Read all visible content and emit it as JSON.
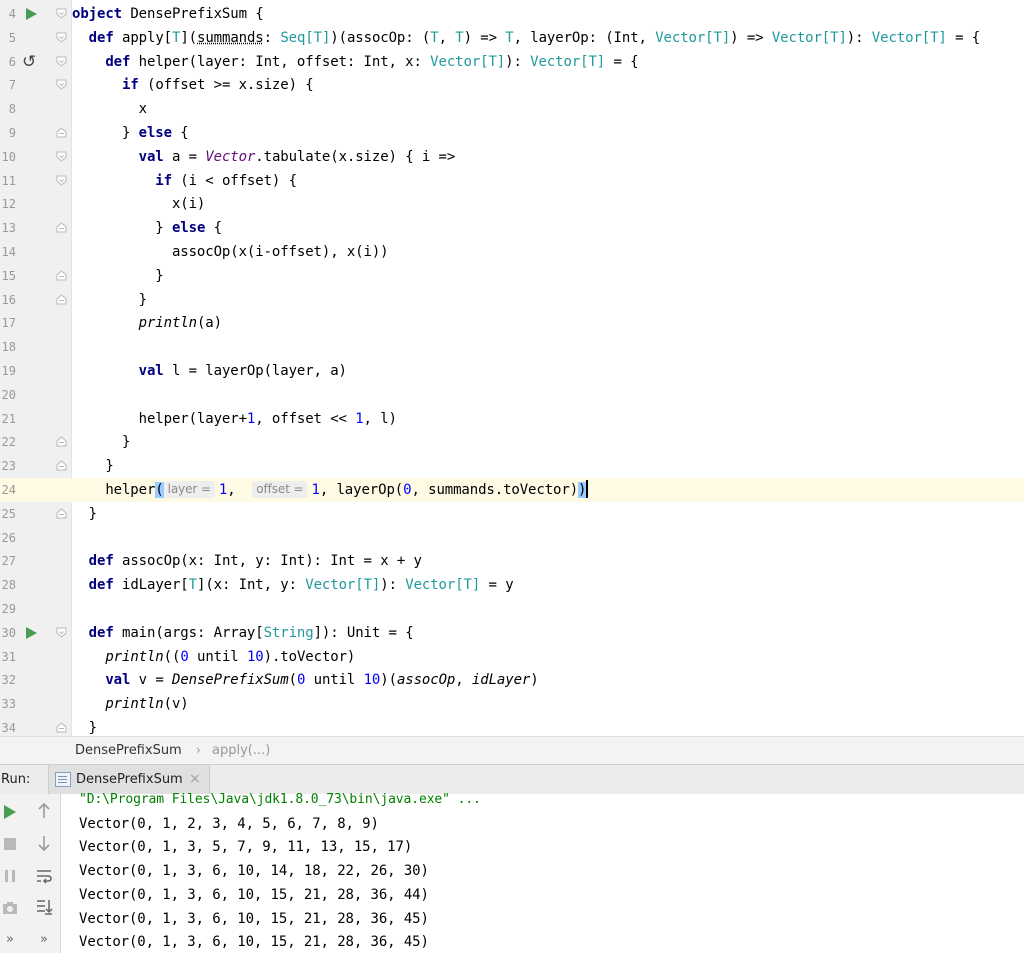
{
  "editor": {
    "file": "DensePrefixSum",
    "lines": [
      {
        "n": "4",
        "tokens": [
          [
            "kw",
            "object"
          ],
          [
            "",
            " DensePrefixSum {"
          ]
        ]
      },
      {
        "n": "5",
        "tokens": [
          [
            "",
            "  "
          ],
          [
            "kw",
            "def"
          ],
          [
            "",
            " apply["
          ],
          [
            "tp",
            "T"
          ],
          [
            "",
            "]("
          ],
          [
            "under",
            "summands"
          ],
          [
            "",
            ": "
          ],
          [
            "tp",
            "Seq[T]"
          ],
          [
            "",
            ")(assocOp: ("
          ],
          [
            "tp",
            "T"
          ],
          [
            "",
            ", "
          ],
          [
            "tp",
            "T"
          ],
          [
            "",
            ") => "
          ],
          [
            "tp",
            "T"
          ],
          [
            "",
            ", layerOp: (Int, "
          ],
          [
            "tp",
            "Vector[T]"
          ],
          [
            "",
            ") => "
          ],
          [
            "tp",
            "Vector[T]"
          ],
          [
            "",
            "): "
          ],
          [
            "tp",
            "Vector[T]"
          ],
          [
            "",
            " = {"
          ]
        ]
      },
      {
        "n": "6",
        "tokens": [
          [
            "",
            "    "
          ],
          [
            "kw",
            "def"
          ],
          [
            "",
            " helper(layer: Int, offset: Int, x: "
          ],
          [
            "tp",
            "Vector[T]"
          ],
          [
            "",
            "): "
          ],
          [
            "tp",
            "Vector[T]"
          ],
          [
            "",
            " = {"
          ]
        ]
      },
      {
        "n": "7",
        "tokens": [
          [
            "",
            "      "
          ],
          [
            "kw",
            "if"
          ],
          [
            "",
            " (offset >= x.size) {"
          ]
        ]
      },
      {
        "n": "8",
        "tokens": [
          [
            "",
            "        x"
          ]
        ]
      },
      {
        "n": "9",
        "tokens": [
          [
            "",
            "      } "
          ],
          [
            "kw",
            "else"
          ],
          [
            "",
            " {"
          ]
        ]
      },
      {
        "n": "10",
        "tokens": [
          [
            "",
            "        "
          ],
          [
            "kw",
            "val"
          ],
          [
            "",
            " a = "
          ],
          [
            "obj",
            "Vector"
          ],
          [
            "",
            ".tabulate(x.size) { i =>"
          ]
        ]
      },
      {
        "n": "11",
        "tokens": [
          [
            "",
            "          "
          ],
          [
            "kw",
            "if"
          ],
          [
            "",
            " (i < offset) {"
          ]
        ]
      },
      {
        "n": "12",
        "tokens": [
          [
            "",
            "            x(i)"
          ]
        ]
      },
      {
        "n": "13",
        "tokens": [
          [
            "",
            "          } "
          ],
          [
            "kw",
            "else"
          ],
          [
            "",
            " {"
          ]
        ]
      },
      {
        "n": "14",
        "tokens": [
          [
            "",
            "            assocOp(x(i-offset), x(i))"
          ]
        ]
      },
      {
        "n": "15",
        "tokens": [
          [
            "",
            "          }"
          ]
        ]
      },
      {
        "n": "16",
        "tokens": [
          [
            "",
            "        }"
          ]
        ]
      },
      {
        "n": "17",
        "tokens": [
          [
            "",
            "        "
          ],
          [
            "it",
            "println"
          ],
          [
            "",
            "(a)"
          ]
        ]
      },
      {
        "n": "18",
        "tokens": []
      },
      {
        "n": "19",
        "tokens": [
          [
            "",
            "        "
          ],
          [
            "kw",
            "val"
          ],
          [
            "",
            " l = layerOp(layer, a)"
          ]
        ]
      },
      {
        "n": "20",
        "tokens": []
      },
      {
        "n": "21",
        "tokens": [
          [
            "",
            "        helper(layer+"
          ],
          [
            "num",
            "1"
          ],
          [
            "",
            ", offset << "
          ],
          [
            "num",
            "1"
          ],
          [
            "",
            ", l)"
          ]
        ]
      },
      {
        "n": "22",
        "tokens": [
          [
            "",
            "      }"
          ]
        ]
      },
      {
        "n": "23",
        "tokens": [
          [
            "",
            "    }"
          ]
        ]
      },
      {
        "n": "24",
        "tokens": [
          [
            "",
            "    helper"
          ],
          [
            "bh",
            "("
          ],
          [
            "hint",
            "layer ="
          ],
          [
            "num",
            "1"
          ],
          [
            "",
            ",  "
          ],
          [
            "hint",
            "offset ="
          ],
          [
            "num",
            "1"
          ],
          [
            "",
            ", layerOp("
          ],
          [
            "num",
            "0"
          ],
          [
            "",
            ", summands.toVector)"
          ],
          [
            "bh",
            ")"
          ],
          [
            "caret",
            ""
          ]
        ]
      },
      {
        "n": "25",
        "tokens": [
          [
            "",
            "  }"
          ]
        ]
      },
      {
        "n": "26",
        "tokens": []
      },
      {
        "n": "27",
        "tokens": [
          [
            "",
            "  "
          ],
          [
            "kw",
            "def"
          ],
          [
            "",
            " assocOp(x: Int, y: Int): Int = x + y"
          ]
        ]
      },
      {
        "n": "28",
        "tokens": [
          [
            "",
            "  "
          ],
          [
            "kw",
            "def"
          ],
          [
            "",
            " idLayer["
          ],
          [
            "tp",
            "T"
          ],
          [
            "",
            "](x: Int, y: "
          ],
          [
            "tp",
            "Vector[T]"
          ],
          [
            "",
            "): "
          ],
          [
            "tp",
            "Vector[T]"
          ],
          [
            "",
            " = y"
          ]
        ]
      },
      {
        "n": "29",
        "tokens": []
      },
      {
        "n": "30",
        "tokens": [
          [
            "",
            "  "
          ],
          [
            "kw",
            "def"
          ],
          [
            "",
            " main(args: Array["
          ],
          [
            "tp",
            "String"
          ],
          [
            "",
            "]): Unit = {"
          ]
        ]
      },
      {
        "n": "31",
        "tokens": [
          [
            "",
            "    "
          ],
          [
            "it",
            "println"
          ],
          [
            "",
            "(("
          ],
          [
            "num",
            "0"
          ],
          [
            "",
            " until "
          ],
          [
            "num",
            "10"
          ],
          [
            "",
            ").toVector)"
          ]
        ]
      },
      {
        "n": "32",
        "tokens": [
          [
            "",
            "    "
          ],
          [
            "kw",
            "val"
          ],
          [
            "",
            " v = "
          ],
          [
            "it",
            "DensePrefixSum"
          ],
          [
            "",
            "("
          ],
          [
            "num",
            "0"
          ],
          [
            "",
            " until "
          ],
          [
            "num",
            "10"
          ],
          [
            "",
            ")("
          ],
          [
            "it",
            "assocOp"
          ],
          [
            "",
            ", "
          ],
          [
            "it",
            "idLayer"
          ],
          [
            "",
            ")"
          ]
        ]
      },
      {
        "n": "33",
        "tokens": [
          [
            "",
            "    "
          ],
          [
            "it",
            "println"
          ],
          [
            "",
            "(v)"
          ]
        ]
      },
      {
        "n": "34",
        "tokens": [
          [
            "",
            "  }"
          ]
        ]
      }
    ]
  },
  "breadcrumb": {
    "object": "DensePrefixSum",
    "method": "apply(...)"
  },
  "run": {
    "label": "Run:",
    "tab_label": "DensePrefixSum",
    "close": "×",
    "console": [
      "\"D:\\Program Files\\Java\\jdk1.8.0_73\\bin\\java.exe\" ...",
      "Vector(0, 1, 2, 3, 4, 5, 6, 7, 8, 9)",
      "Vector(0, 1, 3, 5, 7, 9, 11, 13, 15, 17)",
      "Vector(0, 1, 3, 6, 10, 14, 18, 22, 26, 30)",
      "Vector(0, 1, 3, 6, 10, 15, 21, 28, 36, 44)",
      "Vector(0, 1, 3, 6, 10, 15, 21, 28, 36, 45)",
      "Vector(0, 1, 3, 6, 10, 15, 21, 28, 36, 45)"
    ],
    "toolbar_more": "»",
    "toolbar_more2": "»"
  }
}
